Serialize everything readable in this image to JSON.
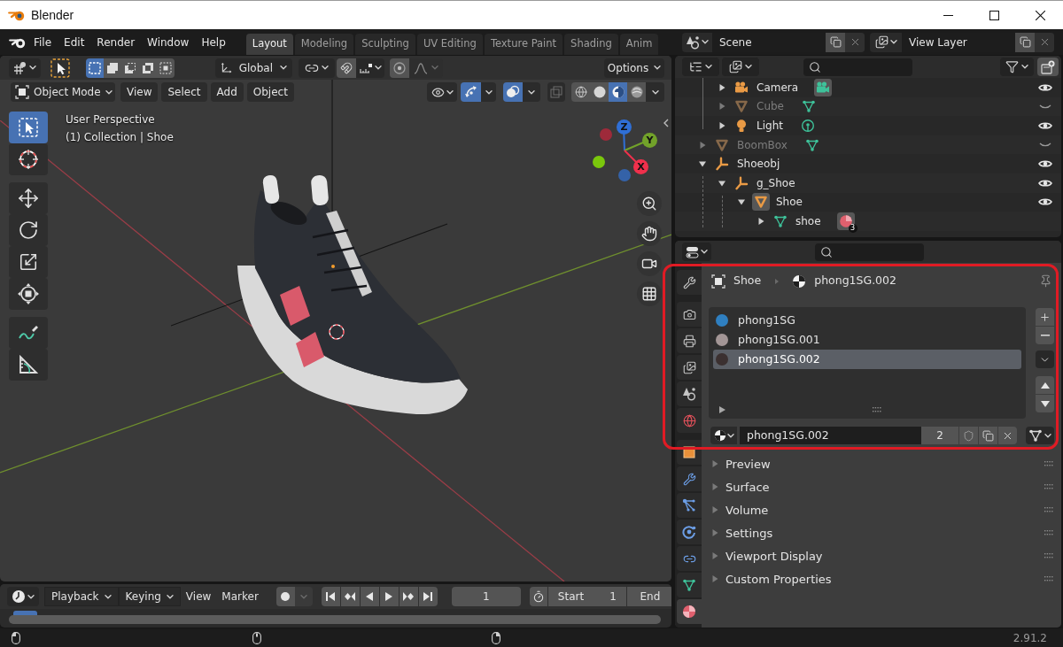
{
  "window": {
    "title": "Blender"
  },
  "topbar": {
    "menus": [
      "File",
      "Edit",
      "Render",
      "Window",
      "Help"
    ],
    "workspaces": [
      {
        "label": "Layout",
        "selected": true
      },
      {
        "label": "Modeling",
        "selected": false
      },
      {
        "label": "Sculpting",
        "selected": false
      },
      {
        "label": "UV Editing",
        "selected": false
      },
      {
        "label": "Texture Paint",
        "selected": false
      },
      {
        "label": "Shading",
        "selected": false
      },
      {
        "label": "Anim",
        "selected": false
      }
    ],
    "scene": "Scene",
    "view_layer": "View Layer"
  },
  "viewport": {
    "select_modes": [
      {
        "kind": "set",
        "selected": true
      },
      {
        "kind": "extend",
        "selected": false
      },
      {
        "kind": "subtract",
        "selected": false
      },
      {
        "kind": "difference",
        "selected": false
      },
      {
        "kind": "intersect",
        "selected": false
      }
    ],
    "orientation": "Global",
    "snap": false,
    "proportional": false,
    "options": "Options",
    "mode": "Object Mode",
    "menus": [
      "View",
      "Select",
      "Add",
      "Object"
    ],
    "gizmos": true,
    "overlays": true,
    "xray": false,
    "shading": [
      {
        "kind": "wireframe",
        "selected": false
      },
      {
        "kind": "solid",
        "selected": false
      },
      {
        "kind": "material",
        "selected": true
      },
      {
        "kind": "rendered",
        "selected": false
      }
    ],
    "tools": [
      {
        "kind": "select_box",
        "selected": true
      },
      {
        "kind": "cursor",
        "selected": false
      },
      {
        "kind": "move",
        "selected": false
      },
      {
        "kind": "rotate",
        "selected": false
      },
      {
        "kind": "scale",
        "selected": false
      },
      {
        "kind": "transform",
        "selected": false
      },
      {
        "kind": "annotate",
        "selected": false
      },
      {
        "kind": "measure",
        "selected": false
      }
    ],
    "info": [
      "User Perspective",
      "(1) Collection | Shoe"
    ],
    "axes": [
      {
        "label": "Z",
        "color": "#2f6fd6"
      },
      {
        "label": "Y",
        "color": "#72a22a"
      },
      {
        "label": "X",
        "color": "#f0304c"
      }
    ]
  },
  "timeline": {
    "menus": [
      {
        "label": "Playback",
        "kind": "dropdown"
      },
      {
        "label": "Keying",
        "kind": "dropdown"
      },
      {
        "label": "View",
        "kind": "menu"
      },
      {
        "label": "Marker",
        "kind": "menu"
      }
    ],
    "auto_keying": false,
    "frame": "1",
    "start_label": "Start",
    "start": "1",
    "end_label": "End"
  },
  "outliner": {
    "rows": [
      {
        "kind": "collection",
        "children": [
          {
            "name": "Camera",
            "kind": "camera",
            "expanded": false,
            "visible": true,
            "active": false,
            "data": {
              "kind": "camera",
              "active": true
            }
          },
          {
            "name": "Cube",
            "kind": "mesh",
            "expanded": false,
            "visible": false,
            "active": false,
            "data": {
              "kind": "mesh",
              "active": false
            }
          },
          {
            "name": "Light",
            "kind": "light",
            "expanded": false,
            "visible": true,
            "active": false,
            "data": {
              "kind": "light",
              "active": false
            }
          }
        ]
      },
      {
        "name": "BoomBox",
        "kind": "mesh",
        "expanded": false,
        "visible": false,
        "active": false,
        "data": {
          "kind": "mesh",
          "active": false
        }
      },
      {
        "name": "Shoeobj",
        "kind": "empty",
        "expanded": true,
        "visible": true,
        "active": false,
        "children": [
          {
            "name": "g_Shoe",
            "kind": "empty",
            "expanded": true,
            "visible": true,
            "active": false,
            "children": [
              {
                "name": "Shoe",
                "kind": "mesh",
                "expanded": true,
                "visible": true,
                "active": true,
                "children": [
                  {
                    "name": "shoe",
                    "kind": "mesh_data",
                    "expanded": false,
                    "active": false,
                    "data": {
                      "kind": "material",
                      "active": true,
                      "badge": "3"
                    }
                  }
                ]
              }
            ]
          }
        ]
      }
    ]
  },
  "properties": {
    "tabs": [
      {
        "kind": "tool",
        "selected": false
      },
      {
        "kind": "render",
        "selected": false
      },
      {
        "kind": "output",
        "selected": false
      },
      {
        "kind": "view_layer",
        "selected": false
      },
      {
        "kind": "scene",
        "selected": false
      },
      {
        "kind": "world",
        "selected": false
      },
      {
        "kind": "object",
        "selected": false
      },
      {
        "kind": "modifiers",
        "selected": false
      },
      {
        "kind": "particles",
        "selected": false
      },
      {
        "kind": "physics",
        "selected": false
      },
      {
        "kind": "constraints",
        "selected": false
      },
      {
        "kind": "data",
        "selected": false
      },
      {
        "kind": "material",
        "selected": true
      }
    ],
    "breadcrumb": [
      {
        "kind": "object",
        "label": "Shoe"
      },
      {
        "kind": "material",
        "label": "phong1SG.002"
      }
    ],
    "slots": [
      {
        "name": "phong1SG",
        "selected": false,
        "color": "#2f7fc0"
      },
      {
        "name": "phong1SG.001",
        "selected": false,
        "color": "#a39696"
      },
      {
        "name": "phong1SG.002",
        "selected": true,
        "color": "#3b3030"
      }
    ],
    "material": {
      "name": "phong1SG.002",
      "users": "2"
    },
    "panels": [
      {
        "label": "Preview",
        "expanded": false
      },
      {
        "label": "Surface",
        "expanded": false
      },
      {
        "label": "Volume",
        "expanded": false
      },
      {
        "label": "Settings",
        "expanded": false
      },
      {
        "label": "Viewport Display",
        "expanded": false
      },
      {
        "label": "Custom Properties",
        "expanded": false
      }
    ]
  },
  "status_bar": {
    "version": "2.91.2"
  }
}
